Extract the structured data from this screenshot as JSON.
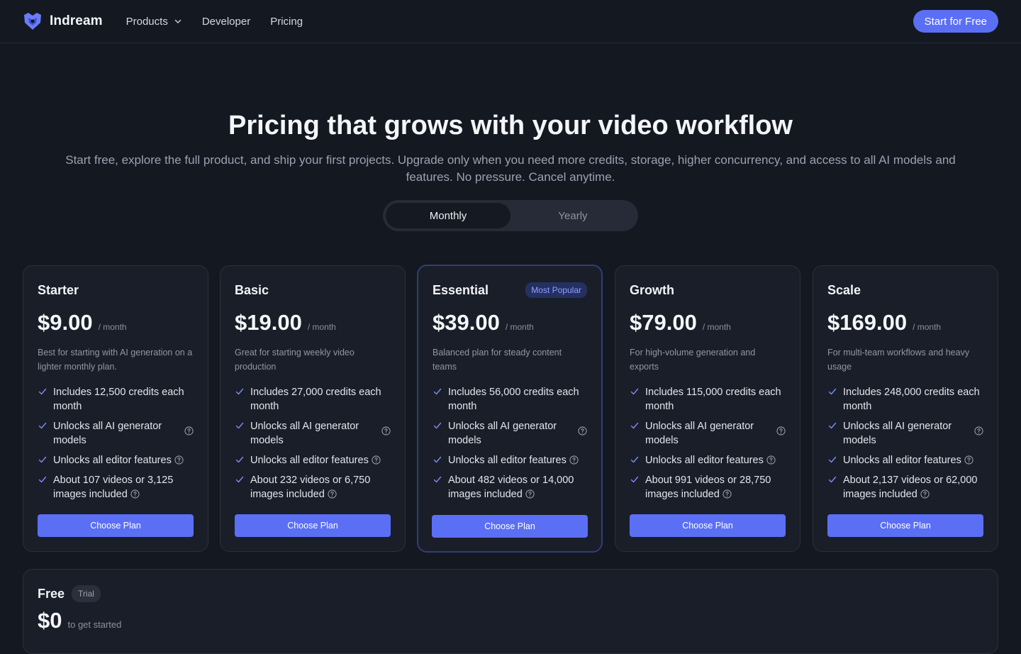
{
  "nav": {
    "brand": "Indream",
    "links": [
      {
        "label": "Products",
        "dropdown": true
      },
      {
        "label": "Developer"
      },
      {
        "label": "Pricing"
      }
    ],
    "cta": "Start for Free"
  },
  "hero": {
    "title": "Pricing that grows with your video workflow",
    "subtitle": "Start free, explore the full product, and ship your first projects. Upgrade only when you need more credits, storage, higher concurrency, and access to all AI models and features. No pressure. Cancel anytime."
  },
  "billing_toggle": {
    "options": [
      "Monthly",
      "Yearly"
    ],
    "selected": "Monthly"
  },
  "colors": {
    "accent": "#5b6ff5",
    "background": "#141821",
    "card": "#1a1e28",
    "popular_border": "#2d3f79"
  },
  "plans": [
    {
      "name": "Starter",
      "price": "$9.00",
      "period": "/ month",
      "description": "Best for starting with AI generation on a lighter monthly plan.",
      "features": [
        "Includes 12,500 credits each month",
        "Unlocks all AI generator models",
        "Unlocks all editor features",
        "About 107 videos or 3,125 images included"
      ],
      "button": "Choose Plan"
    },
    {
      "name": "Basic",
      "price": "$19.00",
      "period": "/ month",
      "description": "Great for starting weekly video production",
      "features": [
        "Includes 27,000 credits each month",
        "Unlocks all AI generator models",
        "Unlocks all editor features",
        "About 232 videos or 6,750 images included"
      ],
      "button": "Choose Plan"
    },
    {
      "name": "Essential",
      "price": "$39.00",
      "period": "/ month",
      "badge": "Most Popular",
      "description": "Balanced plan for steady content teams",
      "features": [
        "Includes 56,000 credits each month",
        "Unlocks all AI generator models",
        "Unlocks all editor features",
        "About 482 videos or 14,000 images included"
      ],
      "button": "Choose Plan"
    },
    {
      "name": "Growth",
      "price": "$79.00",
      "period": "/ month",
      "description": "For high-volume generation and exports",
      "features": [
        "Includes 115,000 credits each month",
        "Unlocks all AI generator models",
        "Unlocks all editor features",
        "About 991 videos or 28,750 images included"
      ],
      "button": "Choose Plan"
    },
    {
      "name": "Scale",
      "price": "$169.00",
      "period": "/ month",
      "description": "For multi-team workflows and heavy usage",
      "features": [
        "Includes 248,000 credits each month",
        "Unlocks all AI generator models",
        "Unlocks all editor features",
        "About 2,137 videos or 62,000 images included"
      ],
      "button": "Choose Plan"
    }
  ],
  "free_plan": {
    "name": "Free",
    "tag": "Trial",
    "price": "$0",
    "period": "to get started"
  }
}
